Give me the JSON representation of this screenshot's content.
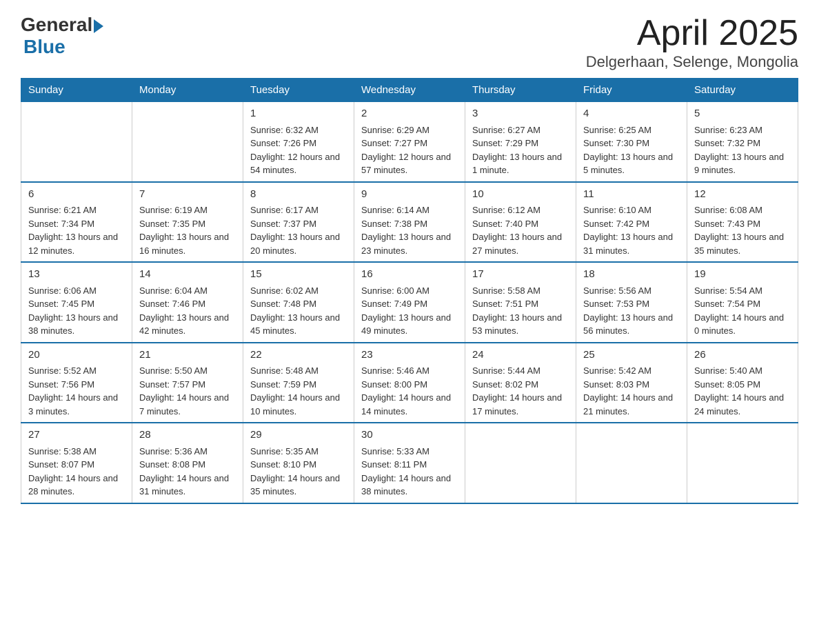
{
  "logo": {
    "general": "General",
    "blue": "Blue"
  },
  "title": "April 2025",
  "subtitle": "Delgerhaan, Selenge, Mongolia",
  "weekdays": [
    "Sunday",
    "Monday",
    "Tuesday",
    "Wednesday",
    "Thursday",
    "Friday",
    "Saturday"
  ],
  "weeks": [
    [
      {
        "day": "",
        "sunrise": "",
        "sunset": "",
        "daylight": ""
      },
      {
        "day": "",
        "sunrise": "",
        "sunset": "",
        "daylight": ""
      },
      {
        "day": "1",
        "sunrise": "Sunrise: 6:32 AM",
        "sunset": "Sunset: 7:26 PM",
        "daylight": "Daylight: 12 hours and 54 minutes."
      },
      {
        "day": "2",
        "sunrise": "Sunrise: 6:29 AM",
        "sunset": "Sunset: 7:27 PM",
        "daylight": "Daylight: 12 hours and 57 minutes."
      },
      {
        "day": "3",
        "sunrise": "Sunrise: 6:27 AM",
        "sunset": "Sunset: 7:29 PM",
        "daylight": "Daylight: 13 hours and 1 minute."
      },
      {
        "day": "4",
        "sunrise": "Sunrise: 6:25 AM",
        "sunset": "Sunset: 7:30 PM",
        "daylight": "Daylight: 13 hours and 5 minutes."
      },
      {
        "day": "5",
        "sunrise": "Sunrise: 6:23 AM",
        "sunset": "Sunset: 7:32 PM",
        "daylight": "Daylight: 13 hours and 9 minutes."
      }
    ],
    [
      {
        "day": "6",
        "sunrise": "Sunrise: 6:21 AM",
        "sunset": "Sunset: 7:34 PM",
        "daylight": "Daylight: 13 hours and 12 minutes."
      },
      {
        "day": "7",
        "sunrise": "Sunrise: 6:19 AM",
        "sunset": "Sunset: 7:35 PM",
        "daylight": "Daylight: 13 hours and 16 minutes."
      },
      {
        "day": "8",
        "sunrise": "Sunrise: 6:17 AM",
        "sunset": "Sunset: 7:37 PM",
        "daylight": "Daylight: 13 hours and 20 minutes."
      },
      {
        "day": "9",
        "sunrise": "Sunrise: 6:14 AM",
        "sunset": "Sunset: 7:38 PM",
        "daylight": "Daylight: 13 hours and 23 minutes."
      },
      {
        "day": "10",
        "sunrise": "Sunrise: 6:12 AM",
        "sunset": "Sunset: 7:40 PM",
        "daylight": "Daylight: 13 hours and 27 minutes."
      },
      {
        "day": "11",
        "sunrise": "Sunrise: 6:10 AM",
        "sunset": "Sunset: 7:42 PM",
        "daylight": "Daylight: 13 hours and 31 minutes."
      },
      {
        "day": "12",
        "sunrise": "Sunrise: 6:08 AM",
        "sunset": "Sunset: 7:43 PM",
        "daylight": "Daylight: 13 hours and 35 minutes."
      }
    ],
    [
      {
        "day": "13",
        "sunrise": "Sunrise: 6:06 AM",
        "sunset": "Sunset: 7:45 PM",
        "daylight": "Daylight: 13 hours and 38 minutes."
      },
      {
        "day": "14",
        "sunrise": "Sunrise: 6:04 AM",
        "sunset": "Sunset: 7:46 PM",
        "daylight": "Daylight: 13 hours and 42 minutes."
      },
      {
        "day": "15",
        "sunrise": "Sunrise: 6:02 AM",
        "sunset": "Sunset: 7:48 PM",
        "daylight": "Daylight: 13 hours and 45 minutes."
      },
      {
        "day": "16",
        "sunrise": "Sunrise: 6:00 AM",
        "sunset": "Sunset: 7:49 PM",
        "daylight": "Daylight: 13 hours and 49 minutes."
      },
      {
        "day": "17",
        "sunrise": "Sunrise: 5:58 AM",
        "sunset": "Sunset: 7:51 PM",
        "daylight": "Daylight: 13 hours and 53 minutes."
      },
      {
        "day": "18",
        "sunrise": "Sunrise: 5:56 AM",
        "sunset": "Sunset: 7:53 PM",
        "daylight": "Daylight: 13 hours and 56 minutes."
      },
      {
        "day": "19",
        "sunrise": "Sunrise: 5:54 AM",
        "sunset": "Sunset: 7:54 PM",
        "daylight": "Daylight: 14 hours and 0 minutes."
      }
    ],
    [
      {
        "day": "20",
        "sunrise": "Sunrise: 5:52 AM",
        "sunset": "Sunset: 7:56 PM",
        "daylight": "Daylight: 14 hours and 3 minutes."
      },
      {
        "day": "21",
        "sunrise": "Sunrise: 5:50 AM",
        "sunset": "Sunset: 7:57 PM",
        "daylight": "Daylight: 14 hours and 7 minutes."
      },
      {
        "day": "22",
        "sunrise": "Sunrise: 5:48 AM",
        "sunset": "Sunset: 7:59 PM",
        "daylight": "Daylight: 14 hours and 10 minutes."
      },
      {
        "day": "23",
        "sunrise": "Sunrise: 5:46 AM",
        "sunset": "Sunset: 8:00 PM",
        "daylight": "Daylight: 14 hours and 14 minutes."
      },
      {
        "day": "24",
        "sunrise": "Sunrise: 5:44 AM",
        "sunset": "Sunset: 8:02 PM",
        "daylight": "Daylight: 14 hours and 17 minutes."
      },
      {
        "day": "25",
        "sunrise": "Sunrise: 5:42 AM",
        "sunset": "Sunset: 8:03 PM",
        "daylight": "Daylight: 14 hours and 21 minutes."
      },
      {
        "day": "26",
        "sunrise": "Sunrise: 5:40 AM",
        "sunset": "Sunset: 8:05 PM",
        "daylight": "Daylight: 14 hours and 24 minutes."
      }
    ],
    [
      {
        "day": "27",
        "sunrise": "Sunrise: 5:38 AM",
        "sunset": "Sunset: 8:07 PM",
        "daylight": "Daylight: 14 hours and 28 minutes."
      },
      {
        "day": "28",
        "sunrise": "Sunrise: 5:36 AM",
        "sunset": "Sunset: 8:08 PM",
        "daylight": "Daylight: 14 hours and 31 minutes."
      },
      {
        "day": "29",
        "sunrise": "Sunrise: 5:35 AM",
        "sunset": "Sunset: 8:10 PM",
        "daylight": "Daylight: 14 hours and 35 minutes."
      },
      {
        "day": "30",
        "sunrise": "Sunrise: 5:33 AM",
        "sunset": "Sunset: 8:11 PM",
        "daylight": "Daylight: 14 hours and 38 minutes."
      },
      {
        "day": "",
        "sunrise": "",
        "sunset": "",
        "daylight": ""
      },
      {
        "day": "",
        "sunrise": "",
        "sunset": "",
        "daylight": ""
      },
      {
        "day": "",
        "sunrise": "",
        "sunset": "",
        "daylight": ""
      }
    ]
  ]
}
